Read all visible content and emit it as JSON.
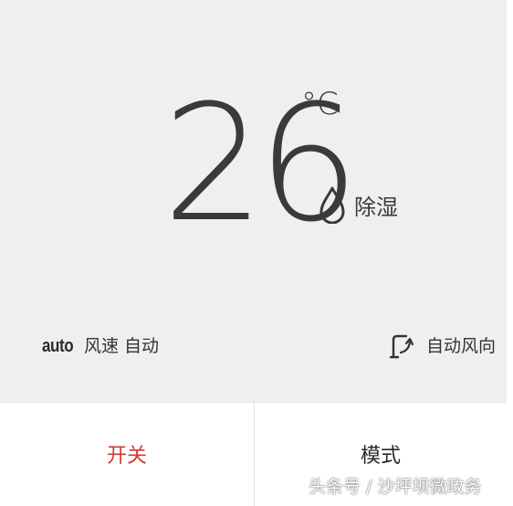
{
  "display": {
    "temperature": "26",
    "unit": "°C",
    "mode_label": "除湿",
    "mode_icon": "water-drop-icon"
  },
  "status": {
    "fan_badge": "auto",
    "fan_label": "风速 自动",
    "swing_icon": "swing-direction-icon",
    "swing_label": "自动风向"
  },
  "buttons": {
    "power_label": "开关",
    "mode_label": "模式"
  },
  "watermark": {
    "text": "头条号 / 沙坪坝微政务"
  },
  "colors": {
    "display_background": "#efefef",
    "text_dark": "#3a3a3a",
    "power_accent": "#d23a32"
  }
}
